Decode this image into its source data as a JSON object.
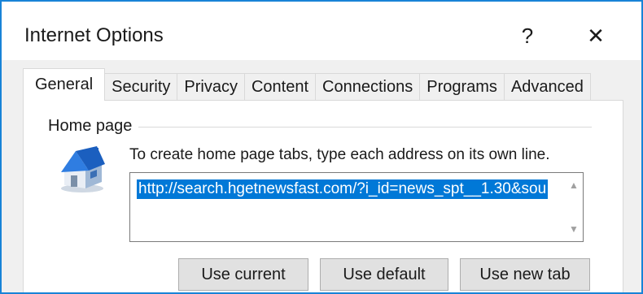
{
  "window": {
    "title": "Internet Options",
    "help_glyph": "?",
    "close_glyph": "✕",
    "accent_color": "#1883d7"
  },
  "tabs": [
    {
      "label": "General",
      "active": true
    },
    {
      "label": "Security",
      "active": false
    },
    {
      "label": "Privacy",
      "active": false
    },
    {
      "label": "Content",
      "active": false
    },
    {
      "label": "Connections",
      "active": false
    },
    {
      "label": "Programs",
      "active": false
    },
    {
      "label": "Advanced",
      "active": false
    }
  ],
  "home_page": {
    "group_label": "Home page",
    "icon": "house-icon",
    "instruction": "To create home page tabs, type each address on its own line.",
    "url_value": "http://search.hgetnewsfast.com/?i_id=news_spt__1.30&sou",
    "selection_color": "#0078d7",
    "buttons": {
      "use_current": "Use current",
      "use_default": "Use default",
      "use_new_tab": "Use new tab"
    }
  }
}
